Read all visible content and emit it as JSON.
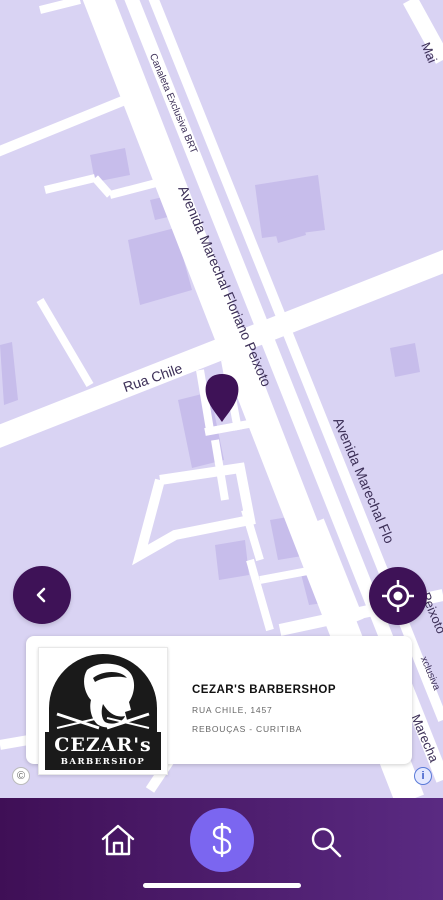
{
  "map": {
    "street_labels": {
      "rua_chile": "Rua Chile",
      "av_marechal_1": "Avenida Marechal Floriano Peixoto",
      "av_marechal_2": "Avenida Marechal Flo",
      "canaleta": "Canaleta Exclusiva BRT",
      "edge_top": "Mai",
      "edge_right_1": "Peixoto",
      "edge_right_2": "xclusiva",
      "edge_right_3": "Marecha"
    },
    "pin_color": "#3e1257"
  },
  "controls": {
    "back_icon": "chevron-left-icon",
    "locate_icon": "crosshair-icon"
  },
  "business": {
    "name": "CEZAR'S BARBERSHOP",
    "address_line1": "RUA CHILE, 1457",
    "address_line2": "REBOUÇAS - CURITIBA",
    "logo": {
      "title": "CEZAR's",
      "subtitle": "BARBERSHOP"
    }
  },
  "bottom_nav": {
    "items": [
      {
        "name": "home",
        "icon": "home-icon"
      },
      {
        "name": "payments",
        "icon": "dollar-icon",
        "active": true
      },
      {
        "name": "search",
        "icon": "search-icon"
      }
    ]
  },
  "colors": {
    "accent": "#3e1257",
    "active_button": "#7b66f0",
    "map_background": "#d9d3f3",
    "map_road": "#ffffff"
  }
}
